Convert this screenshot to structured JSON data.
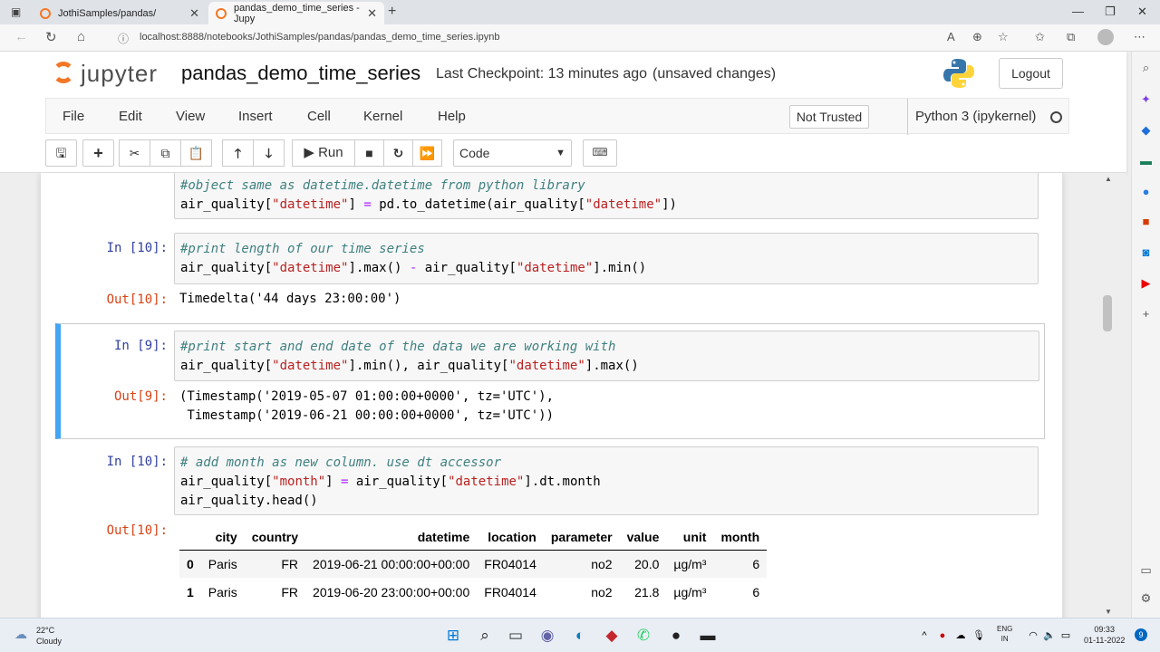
{
  "browser": {
    "tabs": [
      {
        "title": "JothiSamples/pandas/"
      },
      {
        "title": "pandas_demo_time_series - Jupy"
      }
    ],
    "url": "localhost:8888/notebooks/JothiSamples/pandas/pandas_demo_time_series.ipynb"
  },
  "jupyter": {
    "logo_text": "jupyter",
    "notebook_name": "pandas_demo_time_series",
    "checkpoint": "Last Checkpoint: 13 minutes ago",
    "unsaved": "(unsaved changes)",
    "logout_label": "Logout",
    "menu": [
      "File",
      "Edit",
      "View",
      "Insert",
      "Cell",
      "Kernel",
      "Help"
    ],
    "trusted": "Not Trusted",
    "kernel_name": "Python 3 (ipykernel)",
    "run_label": "Run",
    "cell_type": "Code"
  },
  "cells": [
    {
      "line1": "#object same as datetime.datetime from python library",
      "line2": "air_quality[\"datetime\"] = pd.to_datetime(air_quality[\"datetime\"])"
    },
    {
      "in_prompt": "In [10]:",
      "line1": "#print length of our time series",
      "line2": "air_quality[\"datetime\"].max() - air_quality[\"datetime\"].min()",
      "out_prompt": "Out[10]:",
      "output": "Timedelta('44 days 23:00:00')"
    },
    {
      "in_prompt": "In [9]:",
      "line1": "#print start and end date of the data we are working with",
      "line2": "air_quality[\"datetime\"].min(), air_quality[\"datetime\"].max()",
      "out_prompt": "Out[9]:",
      "out1": "(Timestamp('2019-05-07 01:00:00+0000', tz='UTC'),",
      "out2": " Timestamp('2019-06-21 00:00:00+0000', tz='UTC'))"
    },
    {
      "in_prompt": "In [10]:",
      "line1": "# add month as new column. use dt accessor",
      "line2": "air_quality[\"month\"] = air_quality[\"datetime\"].dt.month",
      "line3": "air_quality.head()",
      "out_prompt": "Out[10]:"
    }
  ],
  "table": {
    "headers": [
      "",
      "city",
      "country",
      "datetime",
      "location",
      "parameter",
      "value",
      "unit",
      "month"
    ],
    "rows": [
      [
        "0",
        "Paris",
        "FR",
        "2019-06-21 00:00:00+00:00",
        "FR04014",
        "no2",
        "20.0",
        "µg/m³",
        "6"
      ],
      [
        "1",
        "Paris",
        "FR",
        "2019-06-20 23:00:00+00:00",
        "FR04014",
        "no2",
        "21.8",
        "µg/m³",
        "6"
      ]
    ]
  },
  "taskbar": {
    "temperature": "22°C",
    "weather": "Cloudy",
    "lang1": "ENG",
    "lang2": "IN",
    "time": "09:33",
    "date": "01-11-2022",
    "notifications": "9"
  },
  "colors": {
    "jupyter_orange": "#f37726",
    "selected_cell": "#42a5f5",
    "in_prompt": "#303f9f",
    "out_prompt": "#d84315"
  }
}
